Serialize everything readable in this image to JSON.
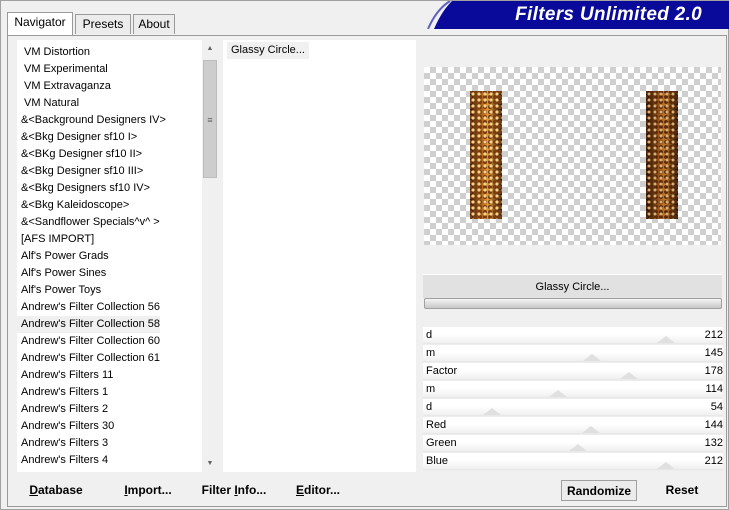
{
  "tabs": [
    {
      "label": "Navigator",
      "active": true
    },
    {
      "label": "Presets",
      "active": false
    },
    {
      "label": "About",
      "active": false
    }
  ],
  "banner": {
    "title": "Filters Unlimited 2.0",
    "color": "#0a0a9a"
  },
  "categories": {
    "items": [
      {
        "label": "VM Distortion",
        "indented": true
      },
      {
        "label": "VM Experimental",
        "indented": true
      },
      {
        "label": "VM Extravaganza",
        "indented": true
      },
      {
        "label": "VM Natural",
        "indented": true
      },
      {
        "label": "&<Background Designers IV>",
        "indented": false
      },
      {
        "label": "&<Bkg Designer sf10 I>",
        "indented": false
      },
      {
        "label": "&<BKg Designer sf10 II>",
        "indented": false
      },
      {
        "label": "&<Bkg Designer sf10 III>",
        "indented": false
      },
      {
        "label": "&<Bkg Designers sf10 IV>",
        "indented": false
      },
      {
        "label": "&<Bkg Kaleidoscope>",
        "indented": false
      },
      {
        "label": "&<Sandflower Specials^v^ >",
        "indented": false
      },
      {
        "label": "[AFS IMPORT]",
        "indented": false
      },
      {
        "label": "Alf's Power Grads",
        "indented": false
      },
      {
        "label": "Alf's Power Sines",
        "indented": false
      },
      {
        "label": "Alf's Power Toys",
        "indented": false
      },
      {
        "label": "Andrew's Filter Collection 56",
        "indented": false
      },
      {
        "label": "Andrew's Filter Collection 58",
        "indented": false,
        "selected": true
      },
      {
        "label": "Andrew's Filter Collection 60",
        "indented": false
      },
      {
        "label": "Andrew's Filter Collection 61",
        "indented": false
      },
      {
        "label": "Andrew's Filters 11",
        "indented": false
      },
      {
        "label": "Andrew's Filters 1",
        "indented": false
      },
      {
        "label": "Andrew's Filters 2",
        "indented": false
      },
      {
        "label": "Andrew's Filters 30",
        "indented": false
      },
      {
        "label": "Andrew's Filters 3",
        "indented": false
      },
      {
        "label": "Andrew's Filters 4",
        "indented": false
      }
    ],
    "scrollbar": {
      "up_icon": "▲",
      "down_icon": "▼",
      "grip_icon": "≡"
    }
  },
  "filters": {
    "items": [
      "Glassy Circle..."
    ]
  },
  "preview": {
    "bar_colors": [
      "#c9741e",
      "#9b5418"
    ]
  },
  "selected_filter": {
    "name": "Glassy Circle..."
  },
  "sliders": [
    {
      "label": "d",
      "value": 212
    },
    {
      "label": "m",
      "value": 145
    },
    {
      "label": "Factor",
      "value": 178
    },
    {
      "label": "m",
      "value": 114
    },
    {
      "label": "d",
      "value": 54
    },
    {
      "label": "Red",
      "value": 144
    },
    {
      "label": "Green",
      "value": 132
    },
    {
      "label": "Blue",
      "value": 212
    }
  ],
  "buttons": {
    "database": {
      "mnemonic": "D",
      "rest": "atabase"
    },
    "import": {
      "mnemonic": "I",
      "rest": "mport..."
    },
    "filter_info": {
      "pre": "Filter ",
      "mnemonic": "I",
      "rest": "nfo..."
    },
    "editor": {
      "mnemonic": "E",
      "rest": "ditor..."
    },
    "randomize": "Randomize",
    "reset": "Reset"
  }
}
